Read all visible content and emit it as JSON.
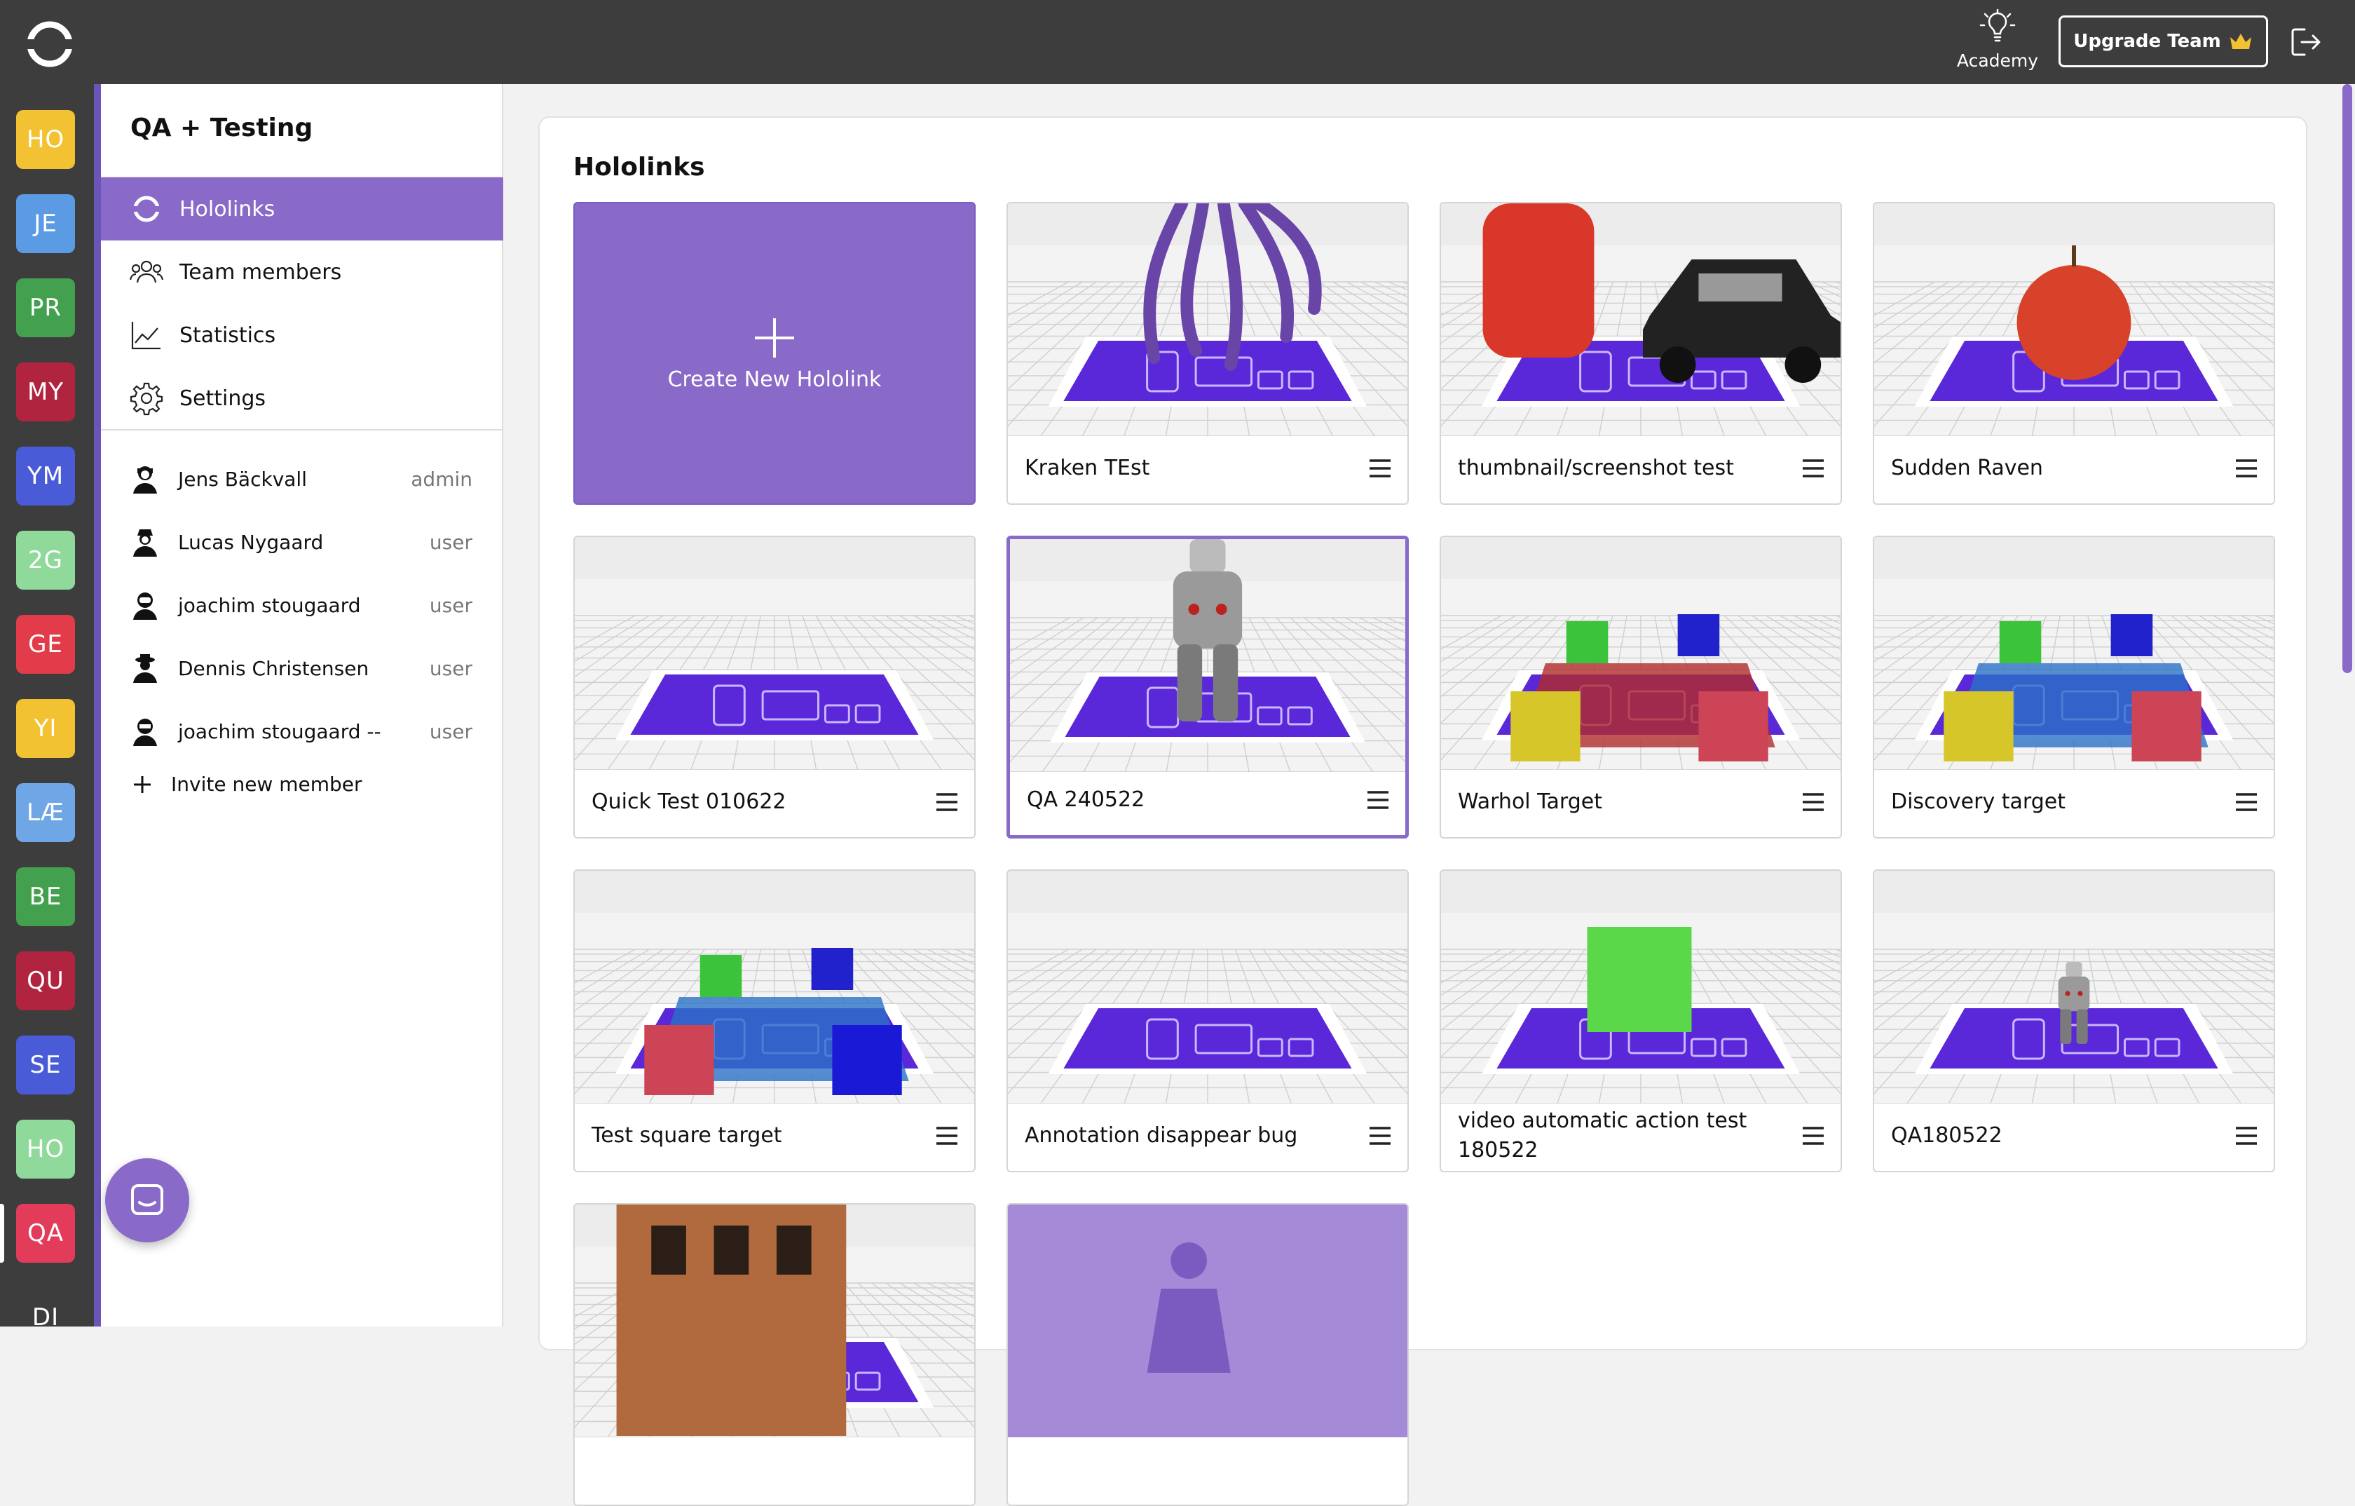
{
  "topbar": {
    "academy_label": "Academy",
    "upgrade_label": "Upgrade Team"
  },
  "workspaces": [
    {
      "initials": "HO",
      "color": "#f2c232"
    },
    {
      "initials": "JE",
      "color": "#5b9be3"
    },
    {
      "initials": "PR",
      "color": "#43a04f"
    },
    {
      "initials": "MY",
      "color": "#b0243f"
    },
    {
      "initials": "YM",
      "color": "#4a5bd8"
    },
    {
      "initials": "2G",
      "color": "#8fd99a"
    },
    {
      "initials": "GE",
      "color": "#e23c4a"
    },
    {
      "initials": "YI",
      "color": "#f2c232"
    },
    {
      "initials": "LÆ",
      "color": "#6fa6e6"
    },
    {
      "initials": "BE",
      "color": "#43a04f"
    },
    {
      "initials": "QU",
      "color": "#b0243f"
    },
    {
      "initials": "SE",
      "color": "#4a5bd8"
    },
    {
      "initials": "HO",
      "color": "#8fd99a"
    },
    {
      "initials": "QA",
      "color": "#e23c5a"
    },
    {
      "initials": "DI",
      "color": "#3d3d3d"
    }
  ],
  "sidebar": {
    "team_name": "QA + Testing",
    "nav": [
      {
        "label": "Hololinks",
        "icon": "hololink-logo-icon"
      },
      {
        "label": "Team members",
        "icon": "people-icon"
      },
      {
        "label": "Statistics",
        "icon": "chart-icon"
      },
      {
        "label": "Settings",
        "icon": "gear-icon"
      }
    ],
    "members": [
      {
        "name": "Jens Bäckvall",
        "role": "admin"
      },
      {
        "name": "Lucas Nygaard",
        "role": "user"
      },
      {
        "name": "joachim stougaard",
        "role": "user"
      },
      {
        "name": "Dennis Christensen",
        "role": "user"
      },
      {
        "name": "joachim stougaard --",
        "role": "user"
      }
    ],
    "invite_label": "Invite new member"
  },
  "main": {
    "title": "Hololinks",
    "create_label": "Create New Hololink",
    "cards": [
      {
        "title": "Kraken TEst",
        "object": "kraken"
      },
      {
        "title": "thumbnail/screenshot test",
        "object": "car"
      },
      {
        "title": "Sudden Raven",
        "object": "apple"
      },
      {
        "title": "Quick Test 010622",
        "object": "none"
      },
      {
        "title": "QA 240522",
        "object": "astronaut"
      },
      {
        "title": "Warhol Target",
        "object": "cubes"
      },
      {
        "title": "Discovery target",
        "object": "cubes2"
      },
      {
        "title": "Test square target",
        "object": "cubes3"
      },
      {
        "title": "Annotation disappear bug",
        "object": "none"
      },
      {
        "title": "video automatic action test 180522",
        "object": "greencube"
      },
      {
        "title": "QA180522",
        "object": "astronaut-small"
      },
      {
        "title": "",
        "object": "house"
      },
      {
        "title": "",
        "object": "figure"
      }
    ]
  },
  "colors": {
    "accent": "#8a6ac8",
    "topbar": "#3d3d3d",
    "target": "#5a28d8"
  }
}
